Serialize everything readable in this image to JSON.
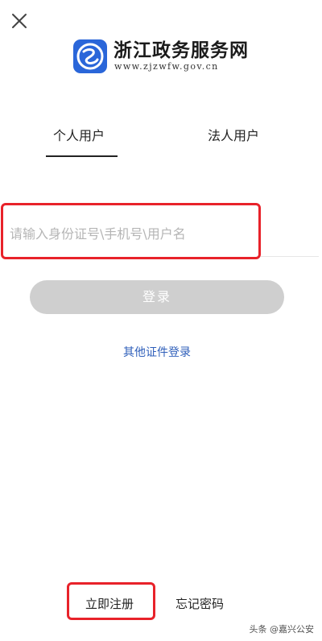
{
  "header": {
    "close_icon": "close-icon",
    "site_name": "浙江政务服务网",
    "site_url": "www.zjzwfw.gov.cn",
    "logo_color": "#2a66d9"
  },
  "tabs": [
    {
      "label": "个人用户",
      "active": true
    },
    {
      "label": "法人用户",
      "active": false
    }
  ],
  "login": {
    "id_field_placeholder": "请输入身份证号\\手机号\\用户名",
    "id_field_value": "",
    "login_label": "登录",
    "other_cert_label": "其他证件登录"
  },
  "footer": {
    "register_label": "立即注册",
    "forgot_label": "忘记密码"
  },
  "watermark": "头条 @嘉兴公安",
  "colors": {
    "highlight_box": "#e8222a",
    "link": "#2f5fba",
    "disabled_button": "#cfcfcf"
  }
}
